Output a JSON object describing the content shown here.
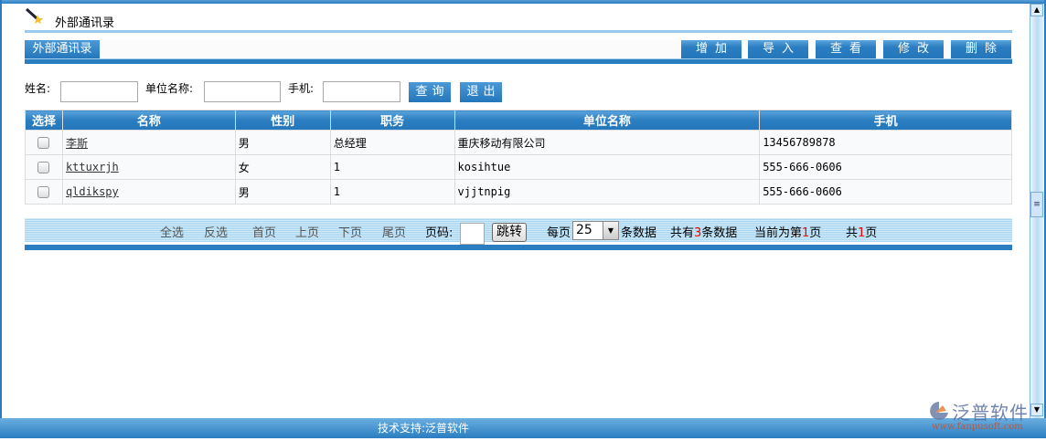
{
  "header": {
    "title": "外部通讯录"
  },
  "tab": {
    "label": "外部通讯录"
  },
  "toolbar": {
    "buttons": [
      "增加",
      "导入",
      "查看",
      "修改",
      "删除"
    ]
  },
  "search": {
    "name_label": "姓名:",
    "name_value": "",
    "unit_label": "单位名称:",
    "unit_value": "",
    "phone_label": "手机:",
    "phone_value": "",
    "query_label": "查询",
    "exit_label": "退出"
  },
  "table": {
    "columns": [
      "选择",
      "名称",
      "性别",
      "职务",
      "单位名称",
      "手机"
    ],
    "rows": [
      {
        "name": "李斯",
        "gender": "男",
        "position": "总经理",
        "unit": "重庆移动有限公司",
        "phone": "13456789878"
      },
      {
        "name": "kttuxrjh",
        "gender": "女",
        "position": "1",
        "unit": "kosihtue",
        "phone": "555-666-0606"
      },
      {
        "name": "qldikspy",
        "gender": "男",
        "position": "1",
        "unit": "vjjtnpig",
        "phone": "555-666-0606"
      }
    ]
  },
  "pager": {
    "select_all": "全选",
    "invert": "反选",
    "first": "首页",
    "prev": "上页",
    "next": "下页",
    "last": "尾页",
    "page_label": "页码:",
    "page_value": "",
    "jump": "跳转",
    "per_page_label": "每页",
    "per_page": "25",
    "per_page_suffix": "条数据",
    "total_prefix": "共有",
    "total": "3",
    "total_suffix": "条数据",
    "current_prefix": "当前为第",
    "current": "1",
    "current_suffix": "页",
    "pages_prefix": "共",
    "pages": "1",
    "pages_suffix": "页"
  },
  "footer": {
    "text": "技术支持:泛普软件"
  },
  "logo": {
    "text": "泛普软件",
    "url_text": "www.fanpusoft.com"
  },
  "colors": {
    "accent": "#2a7dc0",
    "light": "#9cc9ec",
    "red": "#e00000"
  }
}
